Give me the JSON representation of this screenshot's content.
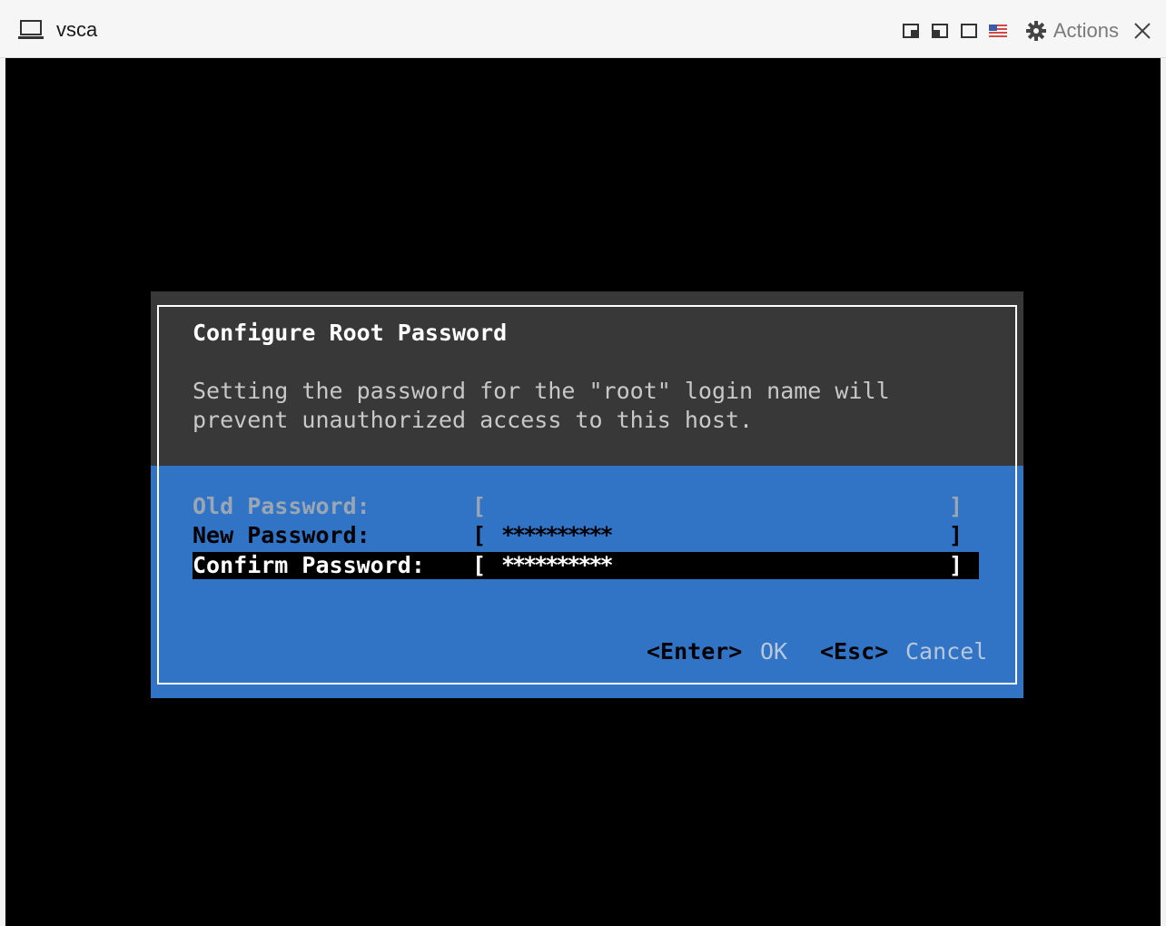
{
  "window": {
    "title": "vsca",
    "icon": "vm-console-icon",
    "toolbar_icons": [
      "fit-window-icon",
      "fit-guest-icon",
      "fullscreen-icon",
      "keyboard-layout-us-icon"
    ],
    "actions_label": "Actions",
    "close_icon": "close-icon"
  },
  "dialog": {
    "title": "Configure Root Password",
    "description_line1": "Setting the password for the \"root\" login name will",
    "description_line2": "prevent unauthorized access to this host.",
    "fields": [
      {
        "label": "Old Password:",
        "left_bracket": "[",
        "value": "",
        "right_bracket": "]",
        "state": "disabled"
      },
      {
        "label": "New Password:",
        "left_bracket": "[",
        "value": "**********",
        "right_bracket": "]",
        "state": "normal"
      },
      {
        "label": "Confirm Password:",
        "left_bracket": "[",
        "value": "**********",
        "right_bracket": "]",
        "state": "selected"
      }
    ],
    "footer": {
      "enter_key": "<Enter>",
      "ok_label": "OK",
      "esc_key": "<Esc>",
      "cancel_label": "Cancel"
    }
  },
  "colors": {
    "dialog_header_bg": "#383838",
    "dialog_body_bg": "#3173c5",
    "selected_row_bg": "#000000",
    "console_bg": "#000000"
  }
}
